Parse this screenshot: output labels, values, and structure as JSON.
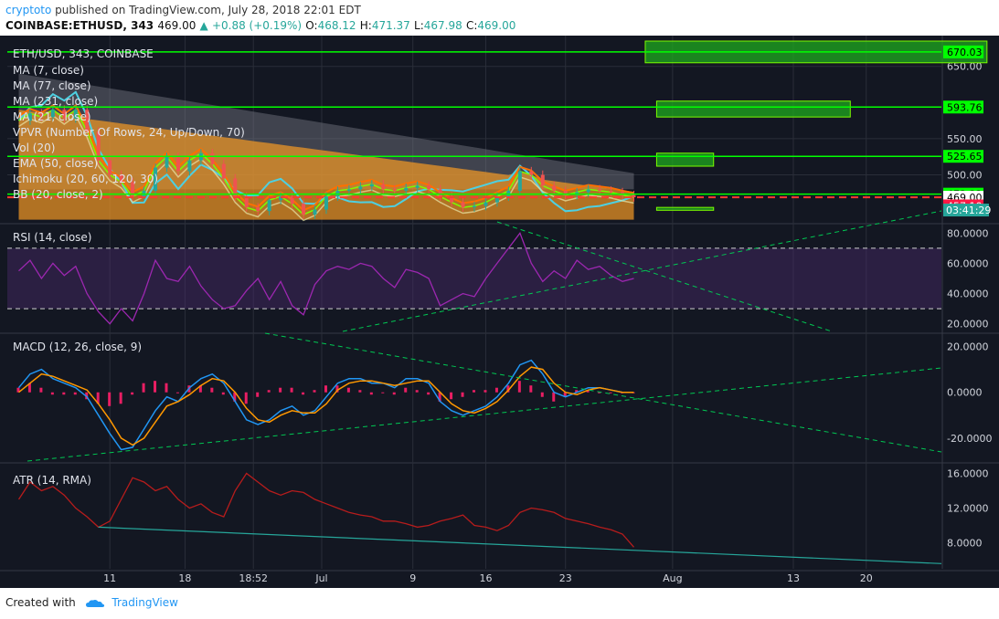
{
  "header": {
    "author": "cryptoto",
    "published": "published on TradingView.com, July 28, 2018 22:01 EDT",
    "symbol": "COINBASE:ETHUSD, 343",
    "price": "469.00",
    "change": "+0.88 (+0.19%)",
    "open_label": "O:",
    "open": "468.12",
    "high_label": "H:",
    "high": "471.37",
    "low_label": "L:",
    "low": "467.98",
    "close_label": "C:",
    "close": "469.00"
  },
  "footer": {
    "created_with": "Created with",
    "brand": "TradingView"
  },
  "colors": {
    "background": "#131722",
    "grid": "#2a2e39",
    "green_level": "#00ff00",
    "red_price": "#ff3b30",
    "rsi": "#9c27b0",
    "macd": "#2196f3",
    "signal": "#ff9800",
    "hist": "#e91e63",
    "atr": "#b71c1c",
    "trend": "#00c853"
  },
  "chart_data": [
    {
      "id": "price",
      "type": "candlestick",
      "title": "ETH/USD, 343, COINBASE",
      "ylim": [
        435,
        685
      ],
      "y_ticks": [
        {
          "v": 650,
          "label": "650.00"
        },
        {
          "v": 550,
          "label": "550.00"
        },
        {
          "v": 500,
          "label": "500.00"
        }
      ],
      "indicators": [
        "MA (7, close)",
        "MA (77, close)",
        "MA (231, close)",
        "MA (21, close)",
        "VPVR (Number Of Rows, 24, Up/Down, 70)",
        "Vol (20)",
        "EMA (50, close)",
        "Ichimoku (20, 60, 120, 30)",
        "BB (20, close, 2)"
      ],
      "price_labels": [
        {
          "v": 670.03,
          "label": "670.03",
          "style": "green"
        },
        {
          "v": 593.76,
          "label": "593.76",
          "style": "green"
        },
        {
          "v": 525.65,
          "label": "525.65",
          "style": "green"
        },
        {
          "v": 473.32,
          "label": "473.32",
          "style": "green"
        },
        {
          "v": 469.0,
          "label": "469.00",
          "style": "white"
        },
        {
          "v": 457.1,
          "label": "457.10",
          "style": "red"
        }
      ],
      "countdown": "03:41:29",
      "zones": [
        {
          "t0": 27.5,
          "t1": 42.5,
          "p0": 655,
          "p1": 685
        },
        {
          "t0": 28.0,
          "t1": 36.5,
          "p0": 580,
          "p1": 602
        },
        {
          "t0": 28.0,
          "t1": 30.5,
          "p0": 512,
          "p1": 530
        },
        {
          "t0": 28.0,
          "t1": 30.5,
          "p0": 451,
          "p1": 455
        }
      ],
      "close_series": [
        [
          0,
          575
        ],
        [
          0.5,
          585
        ],
        [
          1,
          580
        ],
        [
          1.5,
          590
        ],
        [
          2,
          578
        ],
        [
          2.5,
          590
        ],
        [
          3,
          560
        ],
        [
          3.5,
          520
        ],
        [
          4,
          500
        ],
        [
          4.5,
          490
        ],
        [
          5,
          470
        ],
        [
          5.5,
          478
        ],
        [
          6,
          510
        ],
        [
          6.5,
          525
        ],
        [
          7,
          505
        ],
        [
          7.5,
          520
        ],
        [
          8,
          530
        ],
        [
          8.5,
          515
        ],
        [
          9,
          495
        ],
        [
          9.5,
          470
        ],
        [
          10,
          455
        ],
        [
          10.5,
          450
        ],
        [
          11,
          465
        ],
        [
          11.5,
          470
        ],
        [
          12,
          460
        ],
        [
          12.5,
          445
        ],
        [
          13,
          452
        ],
        [
          13.5,
          470
        ],
        [
          14,
          478
        ],
        [
          14.5,
          480
        ],
        [
          15,
          484
        ],
        [
          15.5,
          487
        ],
        [
          16,
          480
        ],
        [
          16.5,
          478
        ],
        [
          17,
          482
        ],
        [
          17.5,
          485
        ],
        [
          18,
          480
        ],
        [
          18.5,
          470
        ],
        [
          19,
          462
        ],
        [
          19.5,
          455
        ],
        [
          20,
          457
        ],
        [
          20.5,
          462
        ],
        [
          21,
          470
        ],
        [
          21.5,
          478
        ],
        [
          22,
          505
        ],
        [
          22.5,
          500
        ],
        [
          23,
          485
        ],
        [
          23.5,
          478
        ],
        [
          24,
          472
        ],
        [
          24.5,
          476
        ],
        [
          25,
          480
        ],
        [
          25.5,
          478
        ],
        [
          26,
          476
        ],
        [
          26.5,
          472
        ],
        [
          27,
          469
        ]
      ]
    },
    {
      "id": "rsi",
      "type": "line",
      "title": "RSI (14, close)",
      "ylim": [
        15,
        85
      ],
      "y_ticks": [
        {
          "v": 80,
          "label": "80.0000"
        },
        {
          "v": 60,
          "label": "60.0000"
        },
        {
          "v": 40,
          "label": "40.0000"
        },
        {
          "v": 20,
          "label": "20.0000"
        }
      ],
      "band": [
        30,
        70
      ],
      "series": [
        [
          0,
          55
        ],
        [
          0.5,
          62
        ],
        [
          1,
          50
        ],
        [
          1.5,
          60
        ],
        [
          2,
          52
        ],
        [
          2.5,
          58
        ],
        [
          3,
          40
        ],
        [
          3.5,
          28
        ],
        [
          4,
          20
        ],
        [
          4.5,
          30
        ],
        [
          5,
          22
        ],
        [
          5.5,
          40
        ],
        [
          6,
          62
        ],
        [
          6.5,
          50
        ],
        [
          7,
          48
        ],
        [
          7.5,
          58
        ],
        [
          8,
          45
        ],
        [
          8.5,
          36
        ],
        [
          9,
          30
        ],
        [
          9.5,
          32
        ],
        [
          10,
          42
        ],
        [
          10.5,
          50
        ],
        [
          11,
          36
        ],
        [
          11.5,
          48
        ],
        [
          12,
          32
        ],
        [
          12.5,
          26
        ],
        [
          13,
          46
        ],
        [
          13.5,
          55
        ],
        [
          14,
          58
        ],
        [
          14.5,
          56
        ],
        [
          15,
          60
        ],
        [
          15.5,
          58
        ],
        [
          16,
          50
        ],
        [
          16.5,
          44
        ],
        [
          17,
          56
        ],
        [
          17.5,
          54
        ],
        [
          18,
          50
        ],
        [
          18.5,
          32
        ],
        [
          19,
          36
        ],
        [
          19.5,
          40
        ],
        [
          20,
          38
        ],
        [
          20.5,
          50
        ],
        [
          21,
          60
        ],
        [
          21.5,
          70
        ],
        [
          22,
          80
        ],
        [
          22.5,
          60
        ],
        [
          23,
          48
        ],
        [
          23.5,
          55
        ],
        [
          24,
          50
        ],
        [
          24.5,
          62
        ],
        [
          25,
          56
        ],
        [
          25.5,
          58
        ],
        [
          26,
          52
        ],
        [
          26.5,
          48
        ],
        [
          27,
          50
        ]
      ]
    },
    {
      "id": "macd",
      "type": "line",
      "title": "MACD (12, 26, close, 9)",
      "ylim": [
        -30,
        25
      ],
      "y_ticks": [
        {
          "v": 20,
          "label": "20.0000"
        },
        {
          "v": 0,
          "label": "0.0000"
        },
        {
          "v": -20,
          "label": "-20.0000"
        }
      ],
      "series": [
        {
          "name": "MACD",
          "values": [
            [
              0,
              2
            ],
            [
              0.5,
              8
            ],
            [
              1,
              10
            ],
            [
              1.5,
              6
            ],
            [
              2,
              4
            ],
            [
              2.5,
              2
            ],
            [
              3,
              -2
            ],
            [
              3.5,
              -10
            ],
            [
              4,
              -18
            ],
            [
              4.5,
              -25
            ],
            [
              5,
              -24
            ],
            [
              5.5,
              -16
            ],
            [
              6,
              -8
            ],
            [
              6.5,
              -2
            ],
            [
              7,
              -4
            ],
            [
              7.5,
              2
            ],
            [
              8,
              6
            ],
            [
              8.5,
              8
            ],
            [
              9,
              4
            ],
            [
              9.5,
              -4
            ],
            [
              10,
              -12
            ],
            [
              10.5,
              -14
            ],
            [
              11,
              -12
            ],
            [
              11.5,
              -8
            ],
            [
              12,
              -6
            ],
            [
              12.5,
              -10
            ],
            [
              13,
              -8
            ],
            [
              13.5,
              -2
            ],
            [
              14,
              4
            ],
            [
              14.5,
              6
            ],
            [
              15,
              6
            ],
            [
              15.5,
              4
            ],
            [
              16,
              4
            ],
            [
              16.5,
              2
            ],
            [
              17,
              6
            ],
            [
              17.5,
              6
            ],
            [
              18,
              4
            ],
            [
              18.5,
              -4
            ],
            [
              19,
              -8
            ],
            [
              19.5,
              -10
            ],
            [
              20,
              -8
            ],
            [
              20.5,
              -6
            ],
            [
              21,
              -2
            ],
            [
              21.5,
              4
            ],
            [
              22,
              12
            ],
            [
              22.5,
              14
            ],
            [
              23,
              8
            ],
            [
              23.5,
              0
            ],
            [
              24,
              -2
            ],
            [
              24.5,
              0
            ],
            [
              25,
              2
            ],
            [
              25.5,
              2
            ],
            [
              26,
              1
            ],
            [
              26.5,
              0
            ],
            [
              27,
              0
            ]
          ]
        },
        {
          "name": "Signal",
          "values": [
            [
              0,
              0
            ],
            [
              0.5,
              4
            ],
            [
              1,
              8
            ],
            [
              1.5,
              7
            ],
            [
              2,
              5
            ],
            [
              2.5,
              3
            ],
            [
              3,
              1
            ],
            [
              3.5,
              -5
            ],
            [
              4,
              -12
            ],
            [
              4.5,
              -20
            ],
            [
              5,
              -23
            ],
            [
              5.5,
              -20
            ],
            [
              6,
              -13
            ],
            [
              6.5,
              -6
            ],
            [
              7,
              -4
            ],
            [
              7.5,
              -1
            ],
            [
              8,
              3
            ],
            [
              8.5,
              6
            ],
            [
              9,
              5
            ],
            [
              9.5,
              0
            ],
            [
              10,
              -7
            ],
            [
              10.5,
              -12
            ],
            [
              11,
              -13
            ],
            [
              11.5,
              -10
            ],
            [
              12,
              -8
            ],
            [
              12.5,
              -9
            ],
            [
              13,
              -9
            ],
            [
              13.5,
              -5
            ],
            [
              14,
              1
            ],
            [
              14.5,
              4
            ],
            [
              15,
              5
            ],
            [
              15.5,
              5
            ],
            [
              16,
              4
            ],
            [
              16.5,
              3
            ],
            [
              17,
              4
            ],
            [
              17.5,
              5
            ],
            [
              18,
              5
            ],
            [
              18.5,
              0
            ],
            [
              19,
              -5
            ],
            [
              19.5,
              -8
            ],
            [
              20,
              -9
            ],
            [
              20.5,
              -7
            ],
            [
              21,
              -4
            ],
            [
              21.5,
              1
            ],
            [
              22,
              7
            ],
            [
              22.5,
              11
            ],
            [
              23,
              10
            ],
            [
              23.5,
              4
            ],
            [
              24,
              0
            ],
            [
              24.5,
              -1
            ],
            [
              25,
              1
            ],
            [
              25.5,
              2
            ],
            [
              26,
              1
            ],
            [
              26.5,
              0
            ],
            [
              27,
              0
            ]
          ]
        }
      ]
    },
    {
      "id": "atr",
      "type": "line",
      "title": "ATR (14, RMA)",
      "ylim": [
        5,
        17
      ],
      "y_ticks": [
        {
          "v": 16,
          "label": "16.0000"
        },
        {
          "v": 12,
          "label": "12.0000"
        },
        {
          "v": 8,
          "label": "8.0000"
        }
      ],
      "series": [
        [
          0,
          13
        ],
        [
          0.5,
          15
        ],
        [
          1,
          14
        ],
        [
          1.5,
          14.5
        ],
        [
          2,
          13.5
        ],
        [
          2.5,
          12
        ],
        [
          3,
          11
        ],
        [
          3.5,
          9.8
        ],
        [
          4,
          10.5
        ],
        [
          4.5,
          13
        ],
        [
          5,
          15.5
        ],
        [
          5.5,
          15
        ],
        [
          6,
          14
        ],
        [
          6.5,
          14.5
        ],
        [
          7,
          13
        ],
        [
          7.5,
          12
        ],
        [
          8,
          12.5
        ],
        [
          8.5,
          11.5
        ],
        [
          9,
          11
        ],
        [
          9.5,
          14
        ],
        [
          10,
          16
        ],
        [
          10.5,
          15
        ],
        [
          11,
          14
        ],
        [
          11.5,
          13.5
        ],
        [
          12,
          14
        ],
        [
          12.5,
          13.8
        ],
        [
          13,
          13
        ],
        [
          13.5,
          12.5
        ],
        [
          14,
          12
        ],
        [
          14.5,
          11.5
        ],
        [
          15,
          11.2
        ],
        [
          15.5,
          11
        ],
        [
          16,
          10.5
        ],
        [
          16.5,
          10.5
        ],
        [
          17,
          10.2
        ],
        [
          17.5,
          9.8
        ],
        [
          18,
          10
        ],
        [
          18.5,
          10.5
        ],
        [
          19,
          10.8
        ],
        [
          19.5,
          11.2
        ],
        [
          20,
          10
        ],
        [
          20.5,
          9.8
        ],
        [
          21,
          9.4
        ],
        [
          21.5,
          10
        ],
        [
          22,
          11.5
        ],
        [
          22.5,
          12
        ],
        [
          23,
          11.8
        ],
        [
          23.5,
          11.5
        ],
        [
          24,
          10.8
        ],
        [
          24.5,
          10.5
        ],
        [
          25,
          10.2
        ],
        [
          25.5,
          9.8
        ],
        [
          26,
          9.5
        ],
        [
          26.5,
          9
        ],
        [
          27,
          7.5
        ]
      ]
    }
  ],
  "time_axis": {
    "labels": [
      {
        "t": 4,
        "label": "11"
      },
      {
        "t": 7.3,
        "label": "18"
      },
      {
        "t": 10.3,
        "label": "18:52"
      },
      {
        "t": 13.3,
        "label": "Jul"
      },
      {
        "t": 17.3,
        "label": "9"
      },
      {
        "t": 20.5,
        "label": "16"
      },
      {
        "t": 24,
        "label": "23"
      },
      {
        "t": 28.7,
        "label": "Aug"
      },
      {
        "t": 34,
        "label": "13"
      },
      {
        "t": 37.2,
        "label": "20"
      }
    ]
  }
}
